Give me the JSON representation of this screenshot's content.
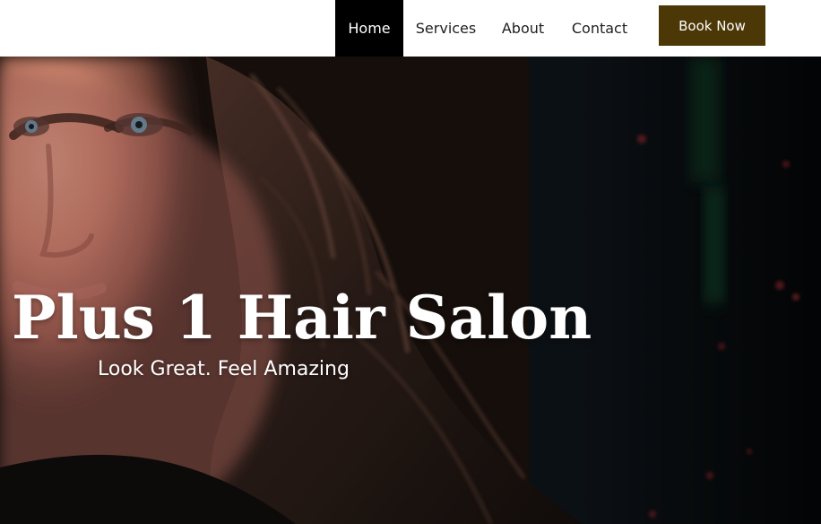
{
  "header": {
    "nav": [
      {
        "label": "Home",
        "active": true
      },
      {
        "label": "Services",
        "active": false
      },
      {
        "label": "About",
        "active": false
      },
      {
        "label": "Contact",
        "active": false
      }
    ],
    "book_now_label": "Book Now"
  },
  "hero": {
    "title": "Plus 1 Hair Salon",
    "subtitle": "Look Great. Feel Amazing"
  },
  "colors": {
    "active_nav": "#000000",
    "book_button": "#4c3706",
    "hero_text": "#ffffff"
  }
}
